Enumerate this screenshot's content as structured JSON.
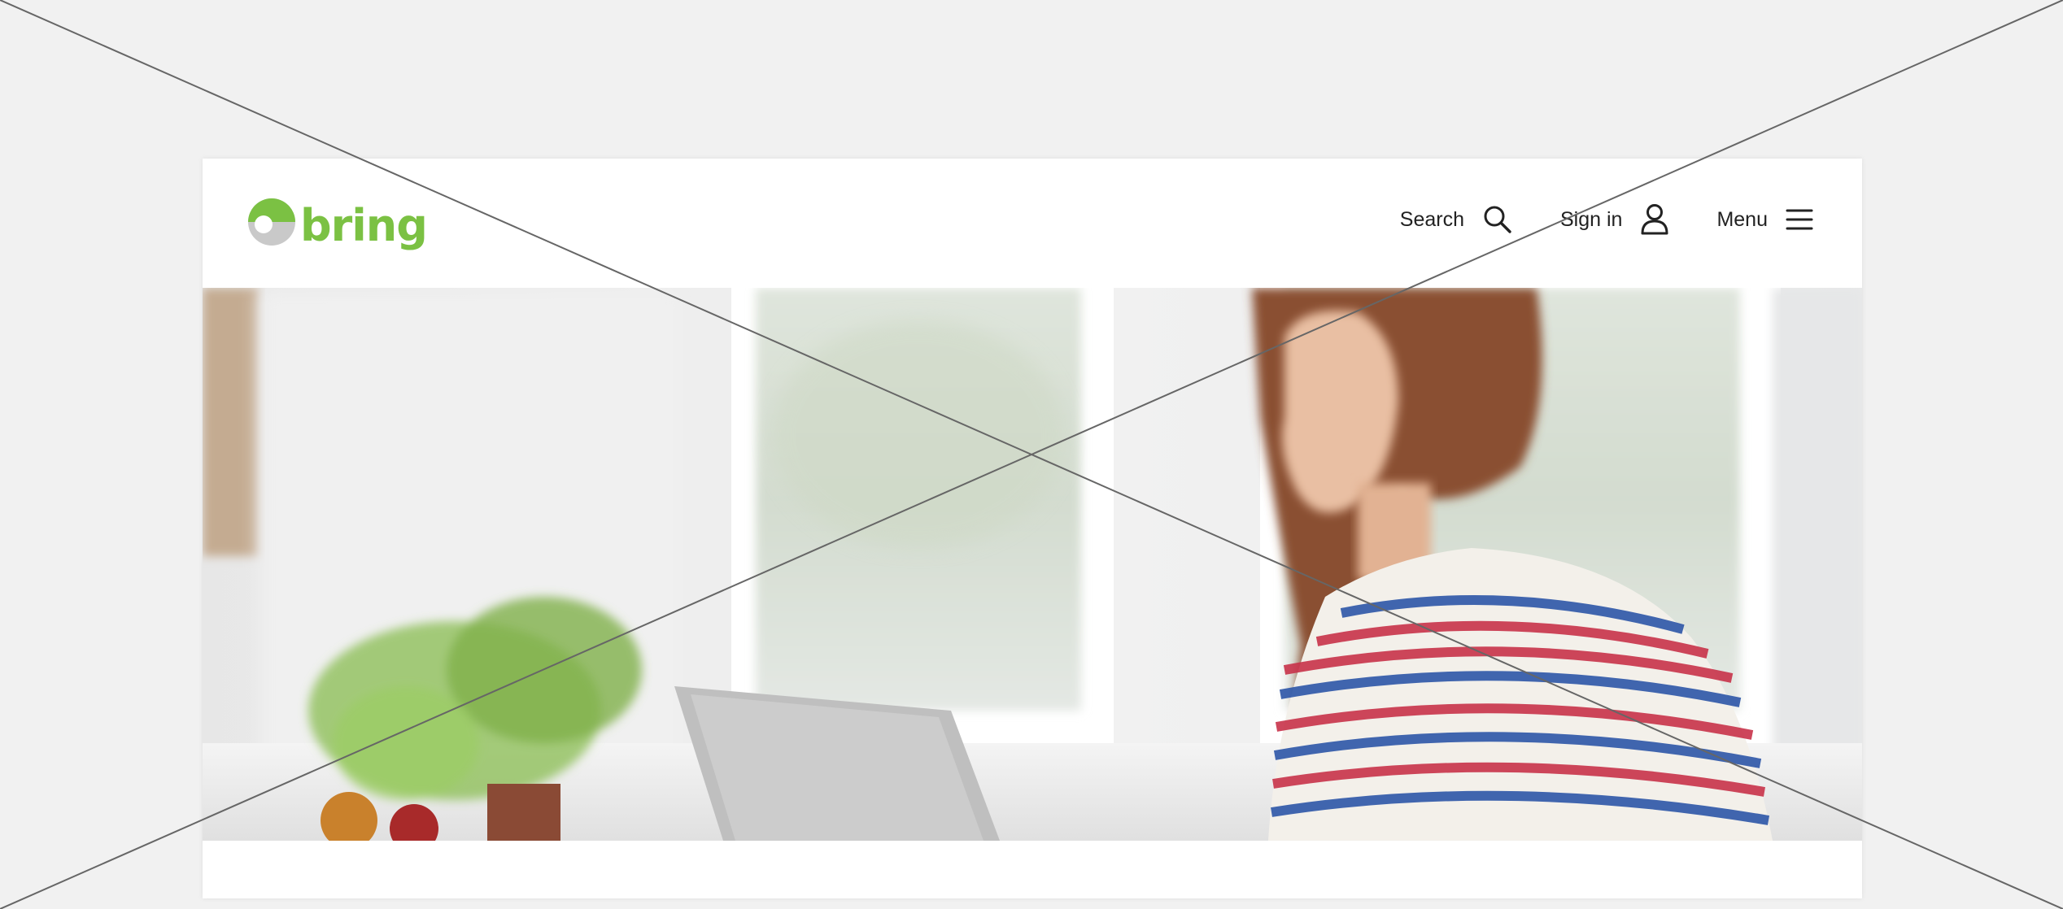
{
  "brand": {
    "name": "bring",
    "color": "#7bc143",
    "gray": "#c9c9c9"
  },
  "nav": {
    "search_label": "Search",
    "search_icon": "search-icon",
    "signin_label": "Sign in",
    "signin_icon": "user-icon",
    "menu_label": "Menu",
    "menu_icon": "hamburger-menu-icon"
  },
  "hero": {
    "image": "woman-working-at-laptop-photo"
  },
  "colors": {
    "page_bg": "#f1f1f1",
    "text": "#222222",
    "overlay_line": "#666666"
  }
}
